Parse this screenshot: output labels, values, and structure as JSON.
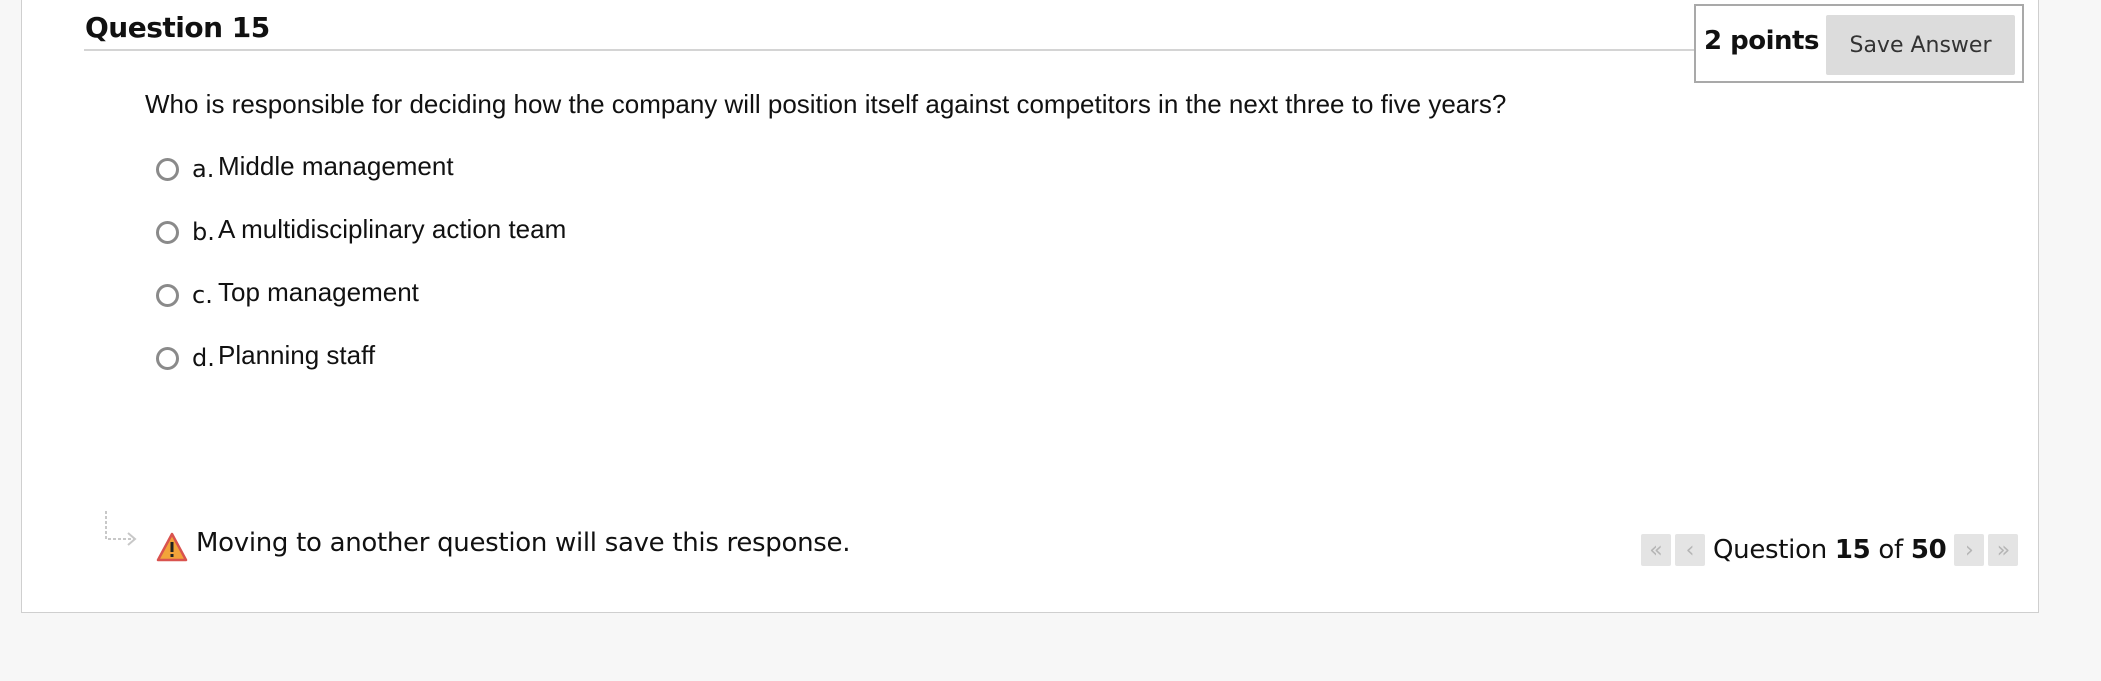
{
  "question": {
    "title": "Question 15",
    "points": "2 points",
    "save_label": "Save Answer",
    "prompt": "Who is responsible for deciding how the company will position itself against competitors in the next three to five years?",
    "options": [
      {
        "letter": "a.",
        "text": "Middle management"
      },
      {
        "letter": "b.",
        "text": "A multidisciplinary action team"
      },
      {
        "letter": "c.",
        "text": "Top management"
      },
      {
        "letter": "d.",
        "text": "Planning staff"
      }
    ]
  },
  "footer": {
    "warning": "Moving to another question will save this response.",
    "warning_icon": "warning-icon"
  },
  "pager": {
    "prefix": "Question",
    "current": "15",
    "of": "of",
    "total": "50",
    "first_icon": "«",
    "prev_icon": "‹",
    "next_icon": "›",
    "last_icon": "»"
  },
  "colors": {
    "card_border": "#cfcfcf",
    "button_bg": "#dcdcdc",
    "warning_fill": "#f2a33a",
    "warning_outline": "#d9534f"
  }
}
